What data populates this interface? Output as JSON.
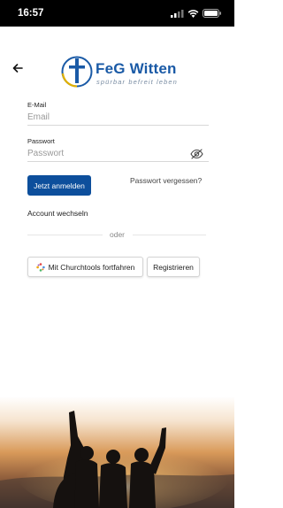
{
  "status_bar": {
    "time": "16:57"
  },
  "logo": {
    "name": "FeG Witten",
    "tagline": "spürbar befreit leben"
  },
  "form": {
    "email_label": "E-Mail",
    "email_placeholder": "Email",
    "password_label": "Passwort",
    "password_placeholder": "Passwort"
  },
  "actions": {
    "login_label": "Jetzt anmelden",
    "forgot_label": "Passwort vergessen?",
    "switch_account_label": "Account wechseln",
    "divider_label": "oder",
    "churchtools_label": "Mit Churchtools fortfahren",
    "register_label": "Registrieren"
  },
  "colors": {
    "primary": "#0d4f9c",
    "logo_blue": "#1a5aa6",
    "logo_gold": "#e0b000"
  },
  "icons": [
    "back-arrow-icon",
    "eye-off-icon",
    "churchtools-icon",
    "signal-icon",
    "wifi-icon",
    "battery-icon"
  ]
}
